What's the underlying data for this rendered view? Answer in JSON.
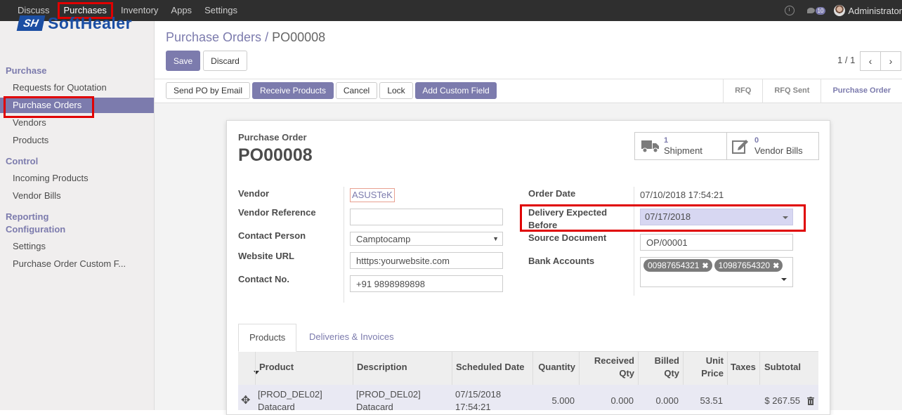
{
  "topbar": {
    "menu": [
      "Discuss",
      "Purchases",
      "Inventory",
      "Apps",
      "Settings"
    ],
    "active_index": 1,
    "chat_count": "10",
    "user": "Administrator"
  },
  "sidebar": {
    "logo_mark": "SH",
    "logo_text": "SoftHealer",
    "sections": {
      "purchase": "Purchase",
      "control": "Control",
      "reporting": "Reporting",
      "configuration": "Configuration"
    },
    "items": {
      "rfq": "Requests for Quotation",
      "purchase_orders": "Purchase Orders",
      "vendors": "Vendors",
      "products": "Products",
      "incoming": "Incoming Products",
      "vendor_bills": "Vendor Bills",
      "settings": "Settings",
      "custom_fields": "Purchase Order Custom F..."
    }
  },
  "breadcrumb": {
    "parent": "Purchase Orders",
    "separator": "/",
    "current": "PO00008"
  },
  "control": {
    "save": "Save",
    "discard": "Discard",
    "pager": "1 / 1"
  },
  "actions": {
    "send_po": "Send PO by Email",
    "receive": "Receive Products",
    "cancel": "Cancel",
    "lock": "Lock",
    "custom_field": "Add Custom Field"
  },
  "stages": [
    "RFQ",
    "RFQ Sent",
    "Purchase Order"
  ],
  "stage_current": "Purchase Order",
  "sheet": {
    "small_title": "Purchase Order",
    "title": "PO00008",
    "shipment_count": "1",
    "shipment_label": "Shipment",
    "bills_count": "0",
    "bills_label": "Vendor Bills"
  },
  "fields": {
    "vendor_label": "Vendor",
    "vendor_value": "ASUSTeK",
    "vendor_ref_label": "Vendor Reference",
    "vendor_ref_value": "",
    "contact_label": "Contact Person",
    "contact_value": "Camptocamp",
    "website_label": "Website URL",
    "website_value": "htttps:yourwebsite.com",
    "contact_no_label": "Contact No.",
    "contact_no_value": "+91 9898989898",
    "order_date_label": "Order Date",
    "order_date_value": "07/10/2018 17:54:21",
    "delivery_label_1": "Delivery Expected",
    "delivery_label_2": "Before",
    "delivery_value": "07/17/2018",
    "source_label": "Source Document",
    "source_value": "OP/00001",
    "bank_label": "Bank Accounts",
    "bank_tags": [
      "00987654321",
      "10987654320"
    ]
  },
  "tabs": [
    "Products",
    "Deliveries & Invoices"
  ],
  "table": {
    "headers": {
      "product": "Product",
      "description": "Description",
      "scheduled": "Scheduled Date",
      "quantity": "Quantity",
      "received_1": "Received",
      "received_2": "Qty",
      "billed_1": "Billed",
      "billed_2": "Qty",
      "unit_1": "Unit",
      "unit_2": "Price",
      "taxes": "Taxes",
      "subtotal": "Subtotal"
    },
    "row": {
      "product_1": "[PROD_DEL02]",
      "product_2": "Datacard",
      "description_1": "[PROD_DEL02]",
      "description_2": "Datacard",
      "scheduled_1": "07/15/2018",
      "scheduled_2": "17:54:21",
      "quantity": "5.000",
      "received": "0.000",
      "billed": "0.000",
      "unit_price": "53.51",
      "taxes": "",
      "subtotal": "$ 267.55"
    }
  }
}
